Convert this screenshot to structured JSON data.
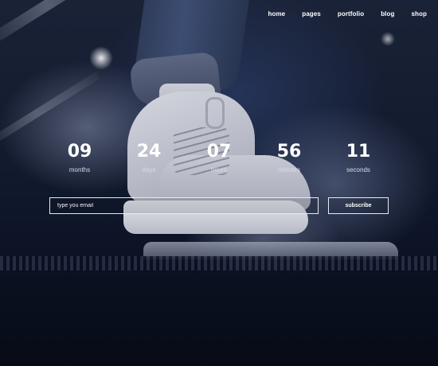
{
  "nav": {
    "items": [
      {
        "label": "home"
      },
      {
        "label": "pages"
      },
      {
        "label": "portfolio"
      },
      {
        "label": "blog"
      },
      {
        "label": "shop"
      }
    ]
  },
  "countdown": {
    "units": [
      {
        "value": "09",
        "label": "months"
      },
      {
        "value": "24",
        "label": "days"
      },
      {
        "value": "07",
        "label": "hours"
      },
      {
        "value": "56",
        "label": "minutes"
      },
      {
        "value": "11",
        "label": "seconds"
      }
    ]
  },
  "subscribe": {
    "placeholder": "type you email",
    "button_label": "subscribe"
  },
  "colors": {
    "text": "#ffffff",
    "background": "#0a1020"
  }
}
